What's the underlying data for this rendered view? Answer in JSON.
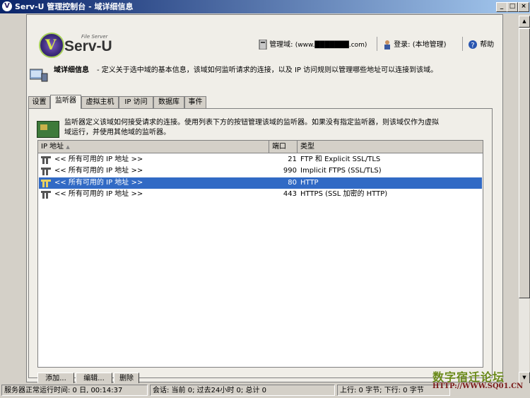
{
  "window": {
    "title": "Serv-U 管理控制台 - 域详细信息",
    "controls": [
      "_",
      "□",
      "×"
    ]
  },
  "header": {
    "logo_small": "File Server",
    "logo_word": "Serv-U",
    "domain_label": "管理域:",
    "domain_value": "(www.███████.com)",
    "login_label": "登录:",
    "login_value": "(本地管理)",
    "help_label": "帮助"
  },
  "page": {
    "title": "域详细信息",
    "description": "- 定义关于选中域的基本信息，该域如何监听请求的连接，以及 IP 访问规则以管理哪些地址可以连接到该域。"
  },
  "tabs": [
    {
      "label": "设置",
      "active": false
    },
    {
      "label": "监听器",
      "active": true
    },
    {
      "label": "虚拟主机",
      "active": false
    },
    {
      "label": "IP 访问",
      "active": false
    },
    {
      "label": "数据库",
      "active": false
    },
    {
      "label": "事件",
      "active": false
    }
  ],
  "listener": {
    "intro_line1": "监听器定义该域如何接受请求的连接。使用列表下方的按钮管理该域的监听器。如果没有指定监听器，则该域仅作为虚拟",
    "intro_line2": "域运行，并使用其他域的监听器。",
    "columns": {
      "ip": "IP 地址",
      "port": "端口",
      "type": "类型"
    },
    "sort_indicator": "▲",
    "rows": [
      {
        "ip": "<< 所有可用的 IP 地址 >>",
        "port": "21",
        "type": "FTP 和 Explicit SSL/TLS",
        "selected": false
      },
      {
        "ip": "<< 所有可用的 IP 地址 >>",
        "port": "990",
        "type": "Implicit FTPS (SSL/TLS)",
        "selected": false
      },
      {
        "ip": "<< 所有可用的 IP 地址 >>",
        "port": "80",
        "type": "HTTP",
        "selected": true
      },
      {
        "ip": "<< 所有可用的 IP 地址 >>",
        "port": "443",
        "type": "HTTPS (SSL 加密的 HTTP)",
        "selected": false
      }
    ],
    "buttons": {
      "add": "添加...",
      "edit": "编辑...",
      "delete": "删除"
    }
  },
  "statusbar": {
    "uptime": "服务器正常运行时间: 0 日, 00:14:37",
    "sessions": "会话: 当前 0; 过去24小时 0; 总计 0",
    "transfer": "上行: 0 字节; 下行: 0 字节"
  },
  "watermark": {
    "text": "数字宿迁论坛",
    "url": "HTTP://WWW.SQ01.CN"
  },
  "colors": {
    "titlebar_start": "#0a246a",
    "selection": "#316ac5",
    "panel": "#f0eee8",
    "logo_green": "#a8d25a"
  }
}
